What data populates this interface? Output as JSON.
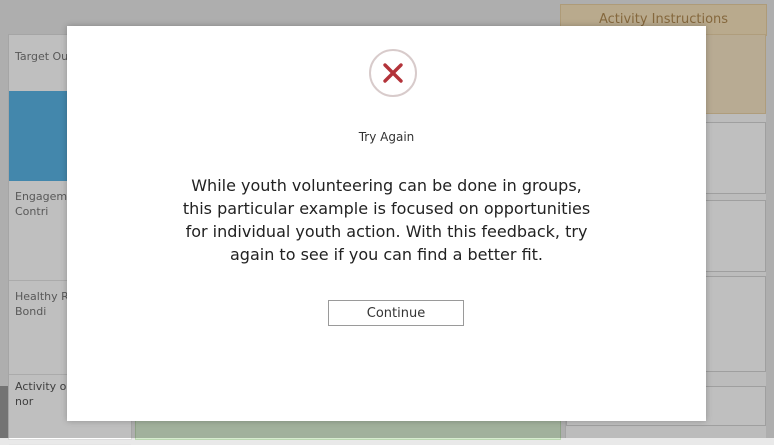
{
  "background": {
    "title": "...",
    "instructions_label": "Activity Instructions",
    "left_rows": [
      "Target Outcom",
      "",
      "Engagement and Contri",
      "Healthy Relatio / Bondi",
      "Activity options do nor"
    ],
    "highlight_color": "#5ab4e6"
  },
  "modal": {
    "icon": "x-mark-icon",
    "icon_color": "#b3333a",
    "status_title": "Try Again",
    "feedback_lines": [
      "While youth volunteering can be done in groups,",
      "this particular example is focused on opportunities",
      "for individual youth action. With this feedback, try",
      "again to see if you can find a better fit."
    ],
    "continue_label": "Continue"
  }
}
